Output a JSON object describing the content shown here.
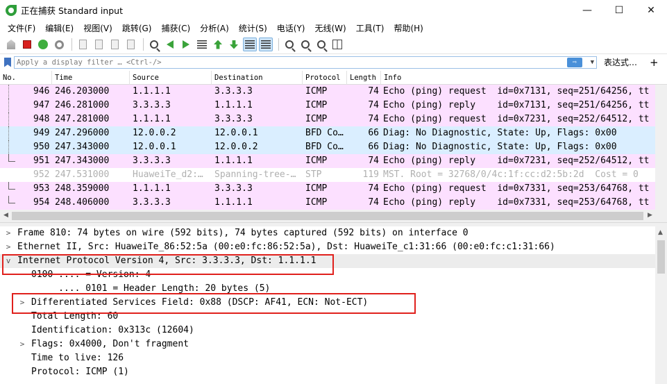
{
  "window": {
    "title": "正在捕获 Standard input",
    "minimize": "—",
    "maximize": "☐",
    "close": "✕"
  },
  "menu": [
    "文件(F)",
    "编辑(E)",
    "视图(V)",
    "跳转(G)",
    "捕获(C)",
    "分析(A)",
    "统计(S)",
    "电话(Y)",
    "无线(W)",
    "工具(T)",
    "帮助(H)"
  ],
  "filter": {
    "placeholder": "Apply a display filter … <Ctrl-/>",
    "apply_icon": "⇨",
    "dropdown": "▼",
    "expression_label": "表达式…",
    "add_label": "+"
  },
  "packet_list": {
    "columns": [
      "No.",
      "Time",
      "Source",
      "Destination",
      "Protocol",
      "Length",
      "Info"
    ],
    "rows": [
      {
        "no": "946",
        "time": "246.203000",
        "src": "1.1.1.1",
        "dst": "3.3.3.3",
        "proto": "ICMP",
        "len": "74",
        "info": "Echo (ping) request  id=0x7131, seq=251/64256, tt",
        "type": "icmp",
        "tree": "line"
      },
      {
        "no": "947",
        "time": "246.281000",
        "src": "3.3.3.3",
        "dst": "1.1.1.1",
        "proto": "ICMP",
        "len": "74",
        "info": "Echo (ping) reply    id=0x7131, seq=251/64256, tt",
        "type": "icmp",
        "tree": "line"
      },
      {
        "no": "948",
        "time": "247.281000",
        "src": "1.1.1.1",
        "dst": "3.3.3.3",
        "proto": "ICMP",
        "len": "74",
        "info": "Echo (ping) request  id=0x7231, seq=252/64512, tt",
        "type": "icmp",
        "tree": "line"
      },
      {
        "no": "949",
        "time": "247.296000",
        "src": "12.0.0.2",
        "dst": "12.0.0.1",
        "proto": "BFD Co…",
        "len": "66",
        "info": "Diag: No Diagnostic, State: Up, Flags: 0x00",
        "type": "bfd",
        "tree": "line"
      },
      {
        "no": "950",
        "time": "247.343000",
        "src": "12.0.0.1",
        "dst": "12.0.0.2",
        "proto": "BFD Co…",
        "len": "66",
        "info": "Diag: No Diagnostic, State: Up, Flags: 0x00",
        "type": "bfd",
        "tree": "line"
      },
      {
        "no": "951",
        "time": "247.343000",
        "src": "3.3.3.3",
        "dst": "1.1.1.1",
        "proto": "ICMP",
        "len": "74",
        "info": "Echo (ping) reply    id=0x7231, seq=252/64512, tt",
        "type": "icmp",
        "tree": "end"
      },
      {
        "no": "952",
        "time": "247.531000",
        "src": "HuaweiTe_d2:…",
        "dst": "Spanning-tree-…",
        "proto": "STP",
        "len": "119",
        "info": "MST. Root = 32768/0/4c:1f:cc:d2:5b:2d  Cost = 0",
        "type": "stp",
        "tree": "none"
      },
      {
        "no": "953",
        "time": "248.359000",
        "src": "1.1.1.1",
        "dst": "3.3.3.3",
        "proto": "ICMP",
        "len": "74",
        "info": "Echo (ping) request  id=0x7331, seq=253/64768, tt",
        "type": "icmp",
        "tree": "end"
      },
      {
        "no": "954",
        "time": "248.406000",
        "src": "3.3.3.3",
        "dst": "1.1.1.1",
        "proto": "ICMP",
        "len": "74",
        "info": "Echo (ping) reply    id=0x7331, seq=253/64768, tt",
        "type": "icmp",
        "tree": "end"
      }
    ]
  },
  "details": [
    {
      "expander": ">",
      "indent": 0,
      "text": "Frame 810: 74 bytes on wire (592 bits), 74 bytes captured (592 bits) on interface 0"
    },
    {
      "expander": ">",
      "indent": 0,
      "text": "Ethernet II, Src: HuaweiTe_86:52:5a (00:e0:fc:86:52:5a), Dst: HuaweiTe_c1:31:66 (00:e0:fc:c1:31:66)"
    },
    {
      "expander": "v",
      "indent": 0,
      "text": "Internet Protocol Version 4, Src: 3.3.3.3, Dst: 1.1.1.1",
      "selected": true
    },
    {
      "expander": "",
      "indent": 1,
      "text": "0100 .... = Version: 4"
    },
    {
      "expander": "",
      "indent": 1,
      "text": "     .... 0101 = Header Length: 20 bytes (5)"
    },
    {
      "expander": ">",
      "indent": 1,
      "text": "Differentiated Services Field: 0x88 (DSCP: AF41, ECN: Not-ECT)"
    },
    {
      "expander": "",
      "indent": 1,
      "text": "Total Length: 60"
    },
    {
      "expander": "",
      "indent": 1,
      "text": "Identification: 0x313c (12604)"
    },
    {
      "expander": ">",
      "indent": 1,
      "text": "Flags: 0x4000, Don't fragment"
    },
    {
      "expander": "",
      "indent": 1,
      "text": "Time to live: 126"
    },
    {
      "expander": "",
      "indent": 1,
      "text": "Protocol: ICMP (1)"
    }
  ],
  "colors": {
    "icmp_row": "#fce0ff",
    "bfd_row": "#daeeff",
    "highlight_box": "#e0201c"
  }
}
